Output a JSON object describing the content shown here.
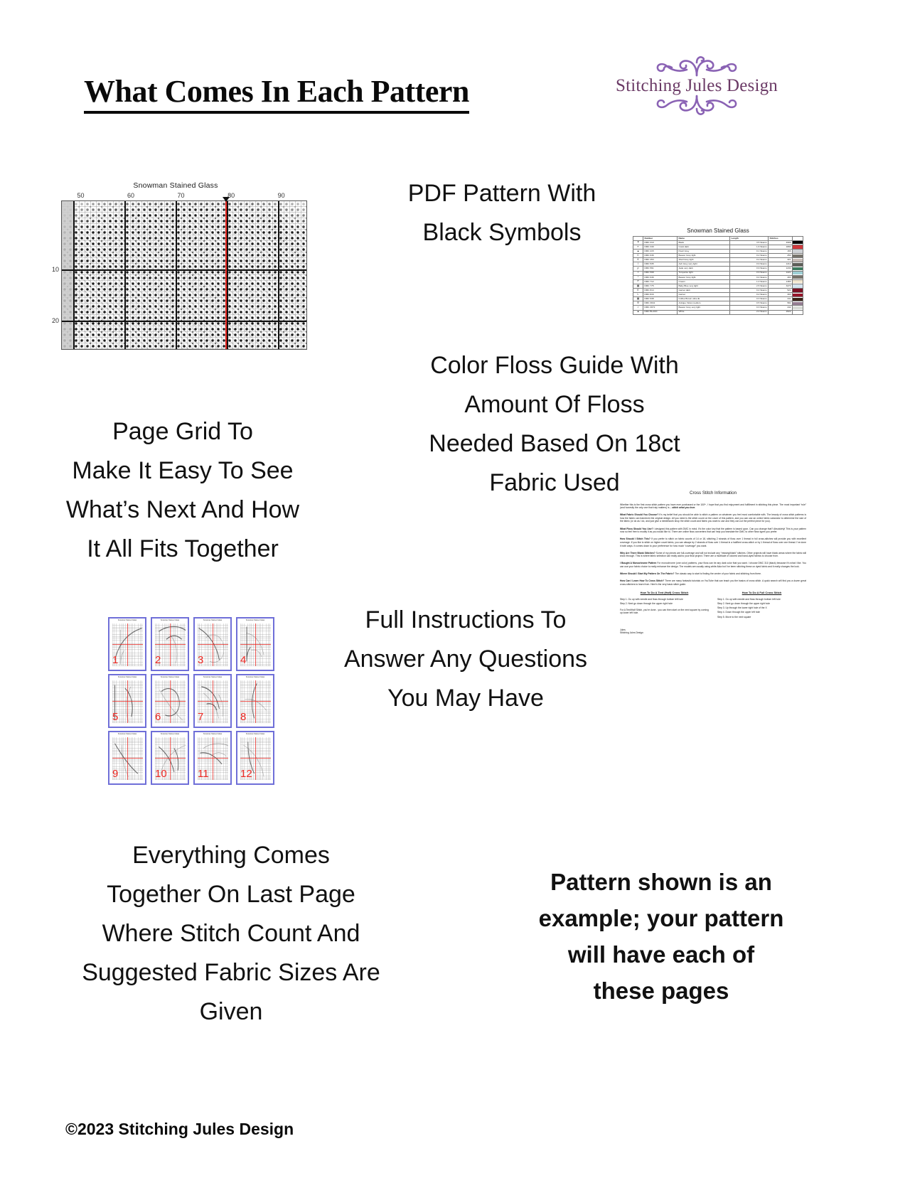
{
  "header": {
    "title": "What Comes In Each Pattern",
    "logo": {
      "name": "Stitching Jules Design",
      "flourish_top": "flourish-ornament-top",
      "flourish_bottom": "flourish-ornament-bottom",
      "color": "#6b3a66",
      "ornament_color": "#8a62b4"
    }
  },
  "captions": {
    "pdf_pattern": "PDF Pattern With\nBlack Symbols",
    "page_grid": "Page Grid To\nMake It Easy To See\nWhat’s Next And How\nIt All Fits Together",
    "floss_guide": "Color Floss Guide With\nAmount Of Floss\nNeeded Based On 18ct\nFabric Used",
    "instructions": "Full Instructions To\nAnswer Any Questions\nYou May Have",
    "last_page": "Everything Comes\nTogether On Last Page\nWhere Stitch Count And\nSuggested Fabric Sizes Are\nGiven",
    "example_note": "Pattern shown is an\nexample; your pattern\nwill have each of\nthese pages"
  },
  "copyright": "©2023 Stitching Jules Design",
  "chart": {
    "title": "Snowman Stained Glass",
    "column_labels": [
      "50",
      "60",
      "70",
      "80",
      "90"
    ],
    "row_labels": [
      "10",
      "20"
    ],
    "center_marker": "center-arrow-marker",
    "center_line_color": "#e8231c"
  },
  "floss_table": {
    "title": "Snowman Stained Glass",
    "headers": [
      "",
      "Number",
      "Name",
      "Length",
      "Stitches",
      ""
    ],
    "rows": [
      {
        "symbol": "●",
        "number": "DMC   310",
        "name": "Black",
        "length": "3.5 Skeins",
        "stitches": "4999",
        "color": "#000000"
      },
      {
        "symbol": "≡",
        "number": "DMC   349",
        "name": "Coral dark",
        "length": "1.6 Skeins",
        "stitches": "1890",
        "color": "#d1383c"
      },
      {
        "symbol": "▲",
        "number": "DMC   415",
        "name": "Pearl Grey",
        "length": "0.1 Skeins",
        "stitches": "166",
        "color": "#cfd2d6"
      },
      {
        "symbol": "C",
        "number": "DMC   646",
        "name": "Beaver Grey light",
        "length": "0.2 Skeins",
        "stitches": "250",
        "color": "#77746c"
      },
      {
        "symbol": "6",
        "number": "DMC   453",
        "name": "Shell Grey light",
        "length": "0.2 Skeins",
        "stitches": "321",
        "color": "#c7bcb6"
      },
      {
        "symbol": "I",
        "number": "DMC   535",
        "name": "Ash Grey very light",
        "length": "0.9 Skeins",
        "stitches": "1210",
        "color": "#5d5e58"
      },
      {
        "symbol": "ρ",
        "number": "DMC   561",
        "name": "Jade very dark",
        "length": "0.9 Skeins",
        "stitches": "1230",
        "color": "#3c7a5e"
      },
      {
        "symbol": "Ŧ",
        "number": "DMC   598",
        "name": "Turquoise light",
        "length": "0.9 Skeins",
        "stitches": "1221",
        "color": "#9ed0d6"
      },
      {
        "symbol": "♪",
        "number": "DMC   646",
        "name": "Beaver Grey light",
        "length": "0.4 Skeins",
        "stitches": "493",
        "color": "#77746c"
      },
      {
        "symbol": "✔",
        "number": "DMC   712",
        "name": "Cream",
        "length": "1.0 Skeins",
        "stitches": "1383",
        "color": "#f2e6cf"
      },
      {
        "symbol": "▩",
        "number": "DMC   775",
        "name": "Baby Blue very light",
        "length": "2.5 Skeins",
        "stitches": "3270",
        "color": "#d4e4ef"
      },
      {
        "symbol": "E",
        "number": "DMC   814",
        "name": "Garnet dark",
        "length": "0.4 Skeins",
        "stitches": "521",
        "color": "#7b1023"
      },
      {
        "symbol": "L",
        "number": "DMC   816",
        "name": "Garnet",
        "length": "0.2 Skeins",
        "stitches": "303",
        "color": "#97152a"
      },
      {
        "symbol": "▩",
        "number": "DMC   938",
        "name": "Coffee Brown ultra dk",
        "length": "0.3 Skeins",
        "stitches": "441",
        "color": "#3a2318"
      },
      {
        "symbol": "Φ",
        "number": "DMC   3041",
        "name": "Antique Violet medium",
        "length": "0.5 Skeins",
        "stitches": "582",
        "color": "#967e93"
      },
      {
        "symbol": ">",
        "number": "DMC   3072",
        "name": "Beaver Grey very light",
        "length": "0.3 Skeins",
        "stitches": "442",
        "color": "#d8dcd6"
      },
      {
        "symbol": "▲",
        "number": "DMC   BLANC",
        "name": "White",
        "length": "2.0 Skeins",
        "stitches": "2622",
        "color": "#ffffff"
      }
    ]
  },
  "page_thumbnails": {
    "title": "Snowman Stained Glass",
    "numbers": [
      "1",
      "2",
      "3",
      "4",
      "5",
      "6",
      "7",
      "8",
      "9",
      "10",
      "11",
      "12"
    ],
    "border_color": "#6f6fd8",
    "number_color": "#ef2a24"
  },
  "instructions_doc": {
    "title": "Cross Stitch Information",
    "intro": "Whether this is the first cross stitch pattern you have ever purchased or the 100ᵗʰ, I hope that you find enjoyment and fulfillment in stitching this piece. The most important “rule” (and honestly the only one that truly matters) is – ",
    "intro_emphasis": "stitch what you love.",
    "sections": [
      {
        "question": "What Fabric Should You Choose?",
        "answer": " It’s my belief that you should be able to stitch a pattern on whatever you feel most comfortable with. The beauty of cross stitch patterns is how the fabric can transform the original design. All you need is the stitch count on the cover of this pattern, and you can use an online fabric calculator to determine the size of the fabric (or do as I do, and just give a needlework shop the stitch count and fabric you want to use and they can cut the perfect piece for you)."
      },
      {
        "question": "What Floss Should You Use?",
        "answer": " I designed this pattern with DMC in mind. It’s the color key that the pattern is based upon. Can you change that? Absolutely! This is your pattern now so feel free to modify it as you would like to. There are online floss converters that can help you translate the DMC to other floss types you prefer."
      },
      {
        "question": "How Should I Stitch This?",
        "answer": " If you prefer to stitch on fabric counts of 14 or 18, stitching 2 strands of floss over 1 thread in full cross-stitches will provide you with excellent coverage. If you like to stitch on higher count fabric, you can always try 2 strands of floss over 1 thread in a half/tent cross-stitch or try 1 thread of floss over one thread. I’ve done it both ways. It comes down to your preference for how much “coverage” you want."
      },
      {
        "question": "Why Are There Blank Stitches?",
        "answer": " Some of my pieces are full-coverage and will not include any “missing/blank” stitches. Other projects will have blank areas where the fabric will show through. This is where fabric selection can really add to your final project. There are a multitude of colored and hand-dyed fabrics to choose from."
      },
      {
        "question": "I Bought A Monochrome Pattern",
        "answer": " For monochrome (one color) patterns, your floss can be any dark color that you want. I choose DMC 310 (black) because it’s what I like. You can use your fabric choice to really enhance the design. The models are usually using white Aida but I’ve been stitching these on dyed fabric and it really changes the look."
      },
      {
        "question": "Where Should I Start My Pattern On The Fabric?",
        "answer": " The classic way to start is finding the center of your fabric and stitching from there."
      },
      {
        "question": "How Can I Learn How To Cross Stitch?",
        "answer": " There are many fantastic tutorials on YouTube that can teach you the basics of cross stitch. A quick search will find you a dozen great cross-stitchers to learn from. Here’s the very basic stitch guide."
      }
    ],
    "tent_stitch": {
      "heading": "How To Do A Tent (Half) Cross Stitch",
      "steps": [
        "Step 1. Go up with needle and floss through bottom left hole",
        "Step 2. Next go down through the upper right hole"
      ],
      "note": "For A Tent/Half Stitch, you’re done - you can then start on the next square by coming up lower left hole."
    },
    "full_stitch": {
      "heading": "How To Do A Full Cross Stitch",
      "steps": [
        "Step 1. Go up with needle and floss through bottom left hole",
        "Step 2. Next go down through the upper right hole",
        "Step 3. Up through the lower right hole of the X",
        "Step 4. Down through the upper left hole",
        "Step 5. Move to the next square"
      ]
    },
    "signature_line1": "Jules",
    "signature_line2": "Stitching Jules Design"
  }
}
